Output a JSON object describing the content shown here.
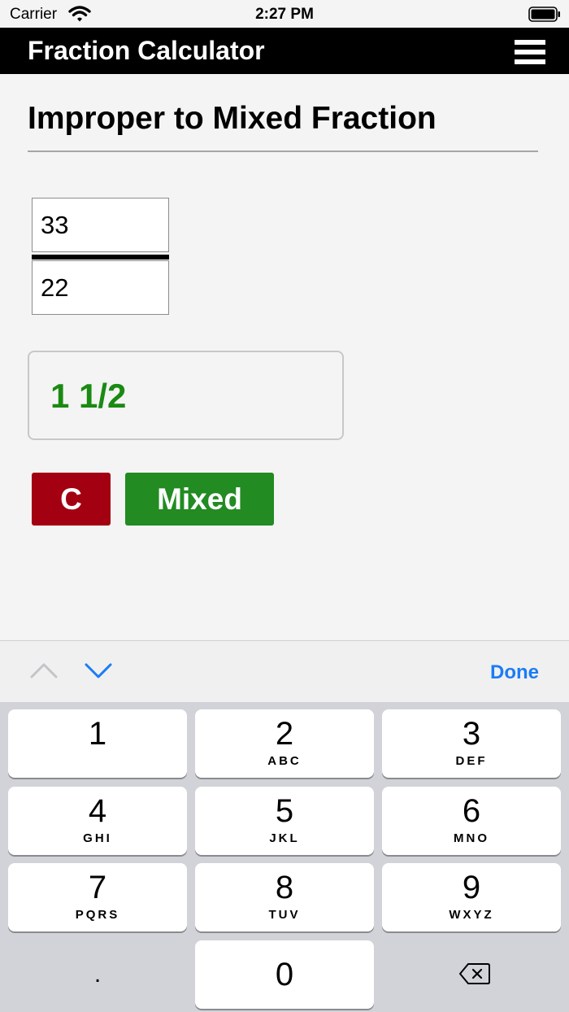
{
  "status_bar": {
    "carrier": "Carrier",
    "time": "2:27 PM"
  },
  "nav": {
    "title": "Fraction Calculator",
    "menu_icon": "hamburger-menu-icon"
  },
  "page": {
    "title": "Improper to Mixed Fraction"
  },
  "fraction": {
    "numerator": "33",
    "denominator": "22"
  },
  "result": {
    "value": "1 1/2",
    "color": "#1a8a12"
  },
  "buttons": {
    "clear": {
      "label": "C",
      "color": "#a30011"
    },
    "mixed": {
      "label": "Mixed",
      "color": "#228b22"
    }
  },
  "keyboard_toolbar": {
    "done_label": "Done",
    "prev_icon": "chevron-up-icon",
    "next_icon": "chevron-down-icon",
    "accent": "#1a7cf5"
  },
  "keyboard": {
    "keys": [
      {
        "digit": "1",
        "letters": ""
      },
      {
        "digit": "2",
        "letters": "ABC"
      },
      {
        "digit": "3",
        "letters": "DEF"
      },
      {
        "digit": "4",
        "letters": "GHI"
      },
      {
        "digit": "5",
        "letters": "JKL"
      },
      {
        "digit": "6",
        "letters": "MNO"
      },
      {
        "digit": "7",
        "letters": "PQRS"
      },
      {
        "digit": "8",
        "letters": "TUV"
      },
      {
        "digit": "9",
        "letters": "WXYZ"
      }
    ],
    "dot": ".",
    "zero": "0",
    "backspace_icon": "backspace-icon"
  }
}
